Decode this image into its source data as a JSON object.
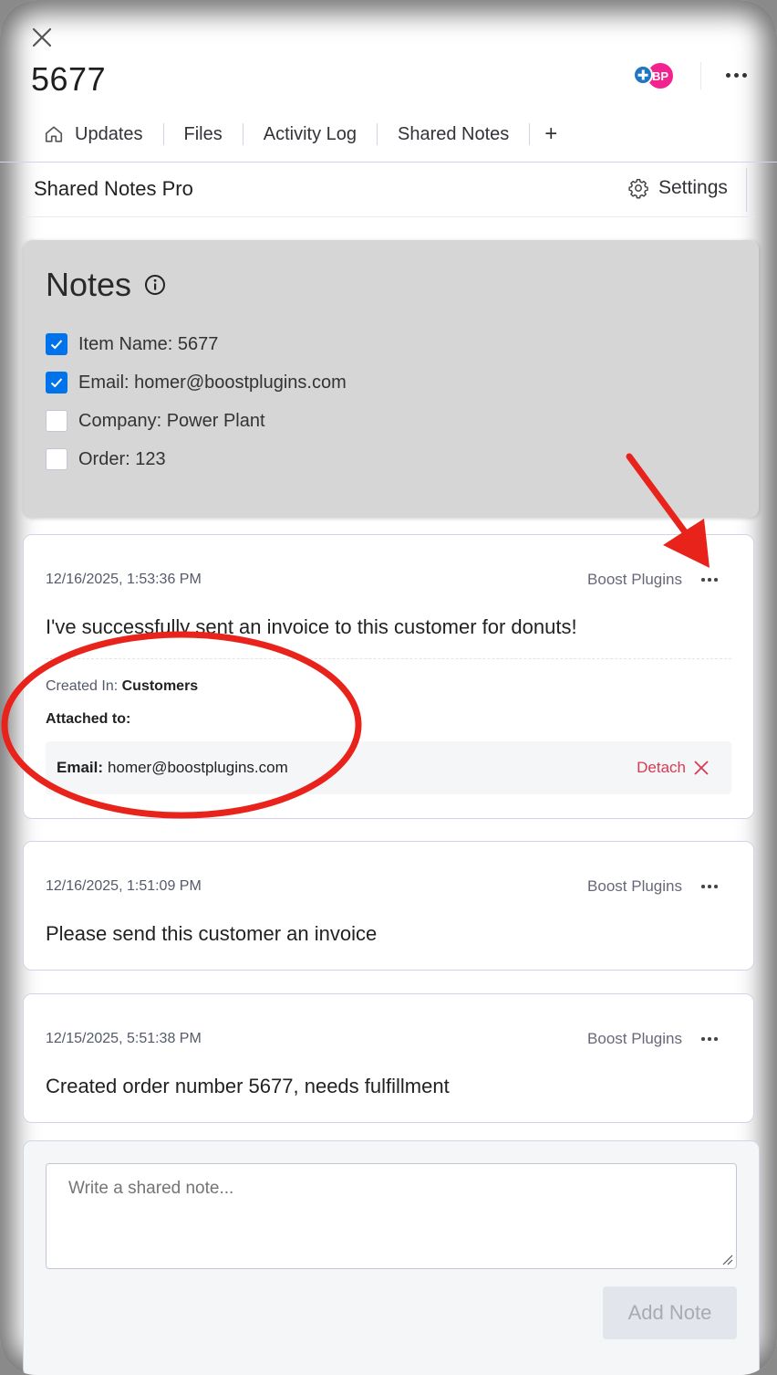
{
  "header": {
    "title": "5677",
    "avatar_initials": "BP",
    "avatar_color": "#f2228e",
    "add_avatar_color": "#1f76c2"
  },
  "tabs": [
    {
      "label": "Updates",
      "icon": "home-icon"
    },
    {
      "label": "Files"
    },
    {
      "label": "Activity Log"
    },
    {
      "label": "Shared Notes"
    },
    {
      "label": "+"
    }
  ],
  "app": {
    "title": "Shared Notes Pro",
    "settings_label": "Settings"
  },
  "notes_panel": {
    "heading": "Notes",
    "checklist": [
      {
        "label": "Item Name: 5677",
        "checked": true
      },
      {
        "label": "Email: homer@boostplugins.com",
        "checked": true
      },
      {
        "label": "Company: Power Plant",
        "checked": false
      },
      {
        "label": "Order: 123",
        "checked": false
      }
    ]
  },
  "notes": [
    {
      "date": "12/16/2025, 1:53:36 PM",
      "author": "Boost Plugins",
      "text": "I've successfully sent an invoice to this customer for donuts!",
      "created_in_label": "Created In:",
      "created_in_value": "Customers",
      "attached_label": "Attached to:",
      "attachment_label": "Email:",
      "attachment_value": "homer@boostplugins.com",
      "detach_label": "Detach"
    },
    {
      "date": "12/16/2025, 1:51:09 PM",
      "author": "Boost Plugins",
      "text": "Please send this customer an invoice"
    },
    {
      "date": "12/15/2025, 5:51:38 PM",
      "author": "Boost Plugins",
      "text": "Created order number 5677, needs fulfillment"
    }
  ],
  "compose": {
    "placeholder": "Write a shared note...",
    "submit_label": "Add Note"
  },
  "colors": {
    "accent": "#0073ea",
    "detach": "#d83a52",
    "annotation": "#e8231b"
  }
}
